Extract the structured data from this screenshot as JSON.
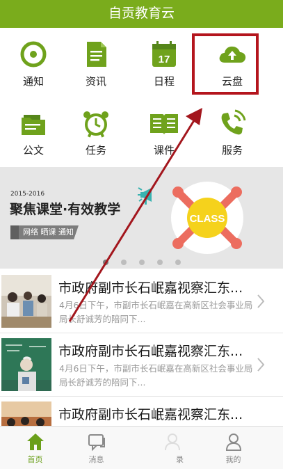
{
  "app": {
    "title": "自贡教育云"
  },
  "grid": {
    "items": [
      {
        "label": "通知",
        "icon": "notice-icon"
      },
      {
        "label": "资讯",
        "icon": "news-doc-icon"
      },
      {
        "label": "日程",
        "icon": "calendar-icon",
        "calendar_day": "17"
      },
      {
        "label": "云盘",
        "icon": "cloud-upload-icon"
      },
      {
        "label": "公文",
        "icon": "document-folder-icon"
      },
      {
        "label": "任务",
        "icon": "alarm-clock-icon"
      },
      {
        "label": "课件",
        "icon": "open-book-icon"
      },
      {
        "label": "服务",
        "icon": "phone-call-icon"
      }
    ]
  },
  "banner": {
    "year": "2015-2016",
    "title": "聚焦课堂·有效教学",
    "tags": "网络 晒课 通知",
    "badge": "CLASS",
    "dot_count": 5,
    "active_dot": 0
  },
  "news": [
    {
      "title": "市政府副市长石岷嘉视察汇东...",
      "desc": "4月6日下午，市副市长石岷嘉在高新区社会事业局局长舒诚芳的陪同下..."
    },
    {
      "title": "市政府副市长石岷嘉视察汇东...",
      "desc": "4月6日下午，市副市长石岷嘉在高新区社会事业局局长舒诚芳的陪同下..."
    },
    {
      "title": "市政府副市长石岷嘉视察汇东...",
      "desc": ""
    }
  ],
  "tabbar": {
    "tabs": [
      {
        "label": "首页",
        "icon": "home-icon",
        "active": true
      },
      {
        "label": "消息",
        "icon": "message-icon",
        "active": false
      },
      {
        "label": "录",
        "icon": "contacts-icon",
        "active": false
      },
      {
        "label": "我的",
        "icon": "profile-icon",
        "active": false
      }
    ]
  },
  "colors": {
    "brand_green": "#7aac1c",
    "highlight_red": "#b4151d",
    "banner_bg": "#e6e6e6",
    "class_yellow": "#f5d21c",
    "class_hands": "#ec6d5f"
  }
}
